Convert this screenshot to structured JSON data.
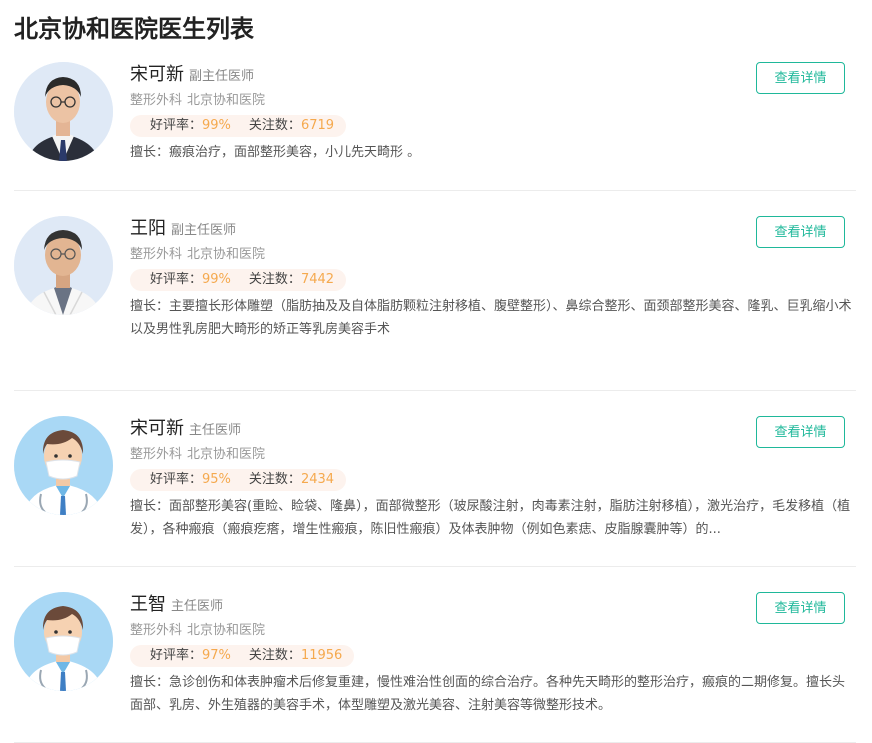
{
  "page_title": "北京协和医院医生列表",
  "labels": {
    "rating": "好评率：",
    "followers": "关注数：",
    "detail_button": "查看详情"
  },
  "colors": {
    "accent": "#1fb89a",
    "stat_value": "#f5a94e",
    "stats_bg": "#fdf3ee"
  },
  "doctors": [
    {
      "name": "宋可新",
      "title": "副主任医师",
      "department": "整形外科",
      "hospital": "北京协和医院",
      "rating": "99%",
      "followers": "6719",
      "specialty": "擅长：瘢痕治疗，面部整形美容，小儿先天畸形 。",
      "avatar": "doctor-photo"
    },
    {
      "name": "王阳",
      "title": "副主任医师",
      "department": "整形外科",
      "hospital": "北京协和医院",
      "rating": "99%",
      "followers": "7442",
      "specialty": "擅长：主要擅长形体雕塑（脂肪抽及及自体脂肪颗粒注射移植、腹壁整形）、鼻综合整形、面颈部整形美容、隆乳、巨乳缩小术以及男性乳房肥大畸形的矫正等乳房美容手术",
      "avatar": "doctor-photo"
    },
    {
      "name": "宋可新",
      "title": "主任医师",
      "department": "整形外科",
      "hospital": "北京协和医院",
      "rating": "95%",
      "followers": "2434",
      "specialty": "擅长：面部整形美容(重睑、睑袋、隆鼻），面部微整形（玻尿酸注射，肉毒素注射，脂肪注射移植），激光治疗，毛发移植（植发），各种瘢痕（瘢痕疙瘩，增生性瘢痕，陈旧性瘢痕）及体表肿物（例如色素痣、皮脂腺囊肿等）的...",
      "avatar": "default-doctor-avatar"
    },
    {
      "name": "王智",
      "title": "主任医师",
      "department": "整形外科",
      "hospital": "北京协和医院",
      "rating": "97%",
      "followers": "11956",
      "specialty": "擅长：急诊创伤和体表肿瘤术后修复重建，慢性难治性创面的综合治疗。各种先天畸形的整形治疗，瘢痕的二期修复。擅长头面部、乳房、外生殖器的美容手术，体型雕塑及激光美容、注射美容等微整形技术。",
      "avatar": "default-doctor-avatar"
    }
  ]
}
